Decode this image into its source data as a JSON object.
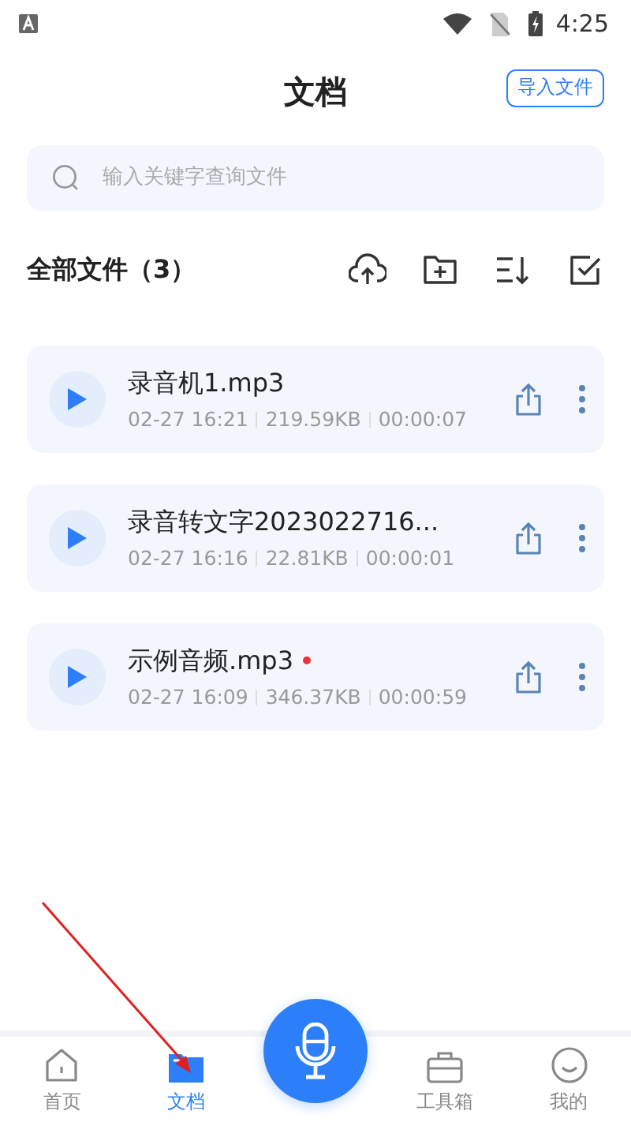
{
  "status_bar": {
    "time": "4:25"
  },
  "header": {
    "title": "文档",
    "import_button": "导入文件"
  },
  "search": {
    "placeholder": "输入关键字查询文件"
  },
  "section": {
    "title": "全部文件（3）"
  },
  "files": [
    {
      "name": "录音机1.mp3",
      "date": "02-27 16:21",
      "size": "219.59KB",
      "duration": "00:00:07",
      "new": false
    },
    {
      "name": "录音转文字2023022716...",
      "date": "02-27 16:16",
      "size": "22.81KB",
      "duration": "00:00:01",
      "new": false
    },
    {
      "name": "示例音频.mp3",
      "date": "02-27 16:09",
      "size": "346.37KB",
      "duration": "00:00:59",
      "new": true
    }
  ],
  "bottom_nav": [
    {
      "kind": "home",
      "label": "首页",
      "selected": false
    },
    {
      "kind": "docs",
      "label": "文档",
      "selected": true
    },
    {
      "kind": "tools",
      "label": "工具箱",
      "selected": false
    },
    {
      "kind": "me",
      "label": "我的",
      "selected": false
    }
  ]
}
